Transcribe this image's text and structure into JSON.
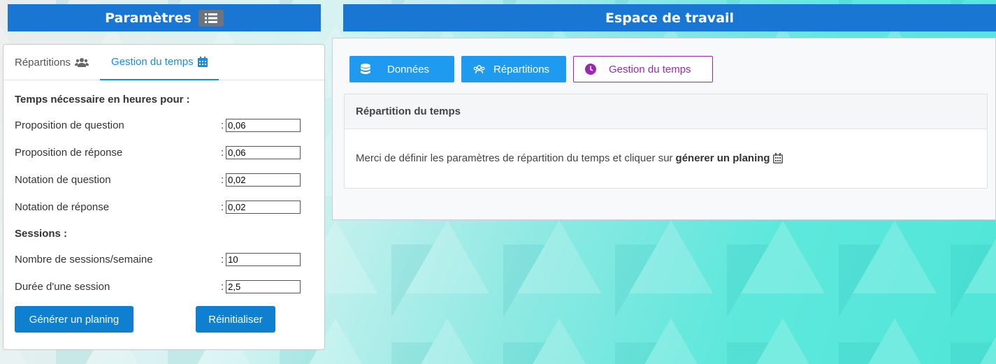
{
  "left_header": {
    "title": "Paramètres",
    "icon": "list-icon"
  },
  "right_header": {
    "title": "Espace de travail"
  },
  "tabs": [
    {
      "label": "Répartitions",
      "icon": "users-icon",
      "active": false
    },
    {
      "label": "Gestion du temps",
      "icon": "calendar-icon",
      "active": true
    }
  ],
  "form": {
    "section1_title": "Temps nécessaire en heures pour :",
    "fields": [
      {
        "label": "Proposition de question",
        "value": "0,06"
      },
      {
        "label": "Proposition de réponse",
        "value": "0,06"
      },
      {
        "label": "Notation de question",
        "value": "0,02"
      },
      {
        "label": "Notation de réponse",
        "value": "0,02"
      }
    ],
    "section2_title": "Sessions :",
    "session_fields": [
      {
        "label": "Nombre de sessions/semaine",
        "value": "10"
      },
      {
        "label": "Durée d'une session",
        "value": "2,5"
      }
    ],
    "colon": ":",
    "generate_label": "Générer un planing",
    "reset_label": "Réinitialiser"
  },
  "workspace": {
    "buttons": [
      {
        "label": "Données",
        "icon": "database-icon"
      },
      {
        "label": "Répartitions",
        "icon": "users-icon"
      },
      {
        "label": "Gestion du temps",
        "icon": "clock-icon"
      }
    ],
    "card_title": "Répartition du temps",
    "card_text": "Merci de définir les paramètres de répartition du temps et cliquer sur",
    "card_bold": "génerer un planing"
  },
  "colors": {
    "header_blue": "#1976d2",
    "button_blue": "#1e9af0",
    "purple": "#9c27b0",
    "tab_active": "#1e88e5"
  }
}
